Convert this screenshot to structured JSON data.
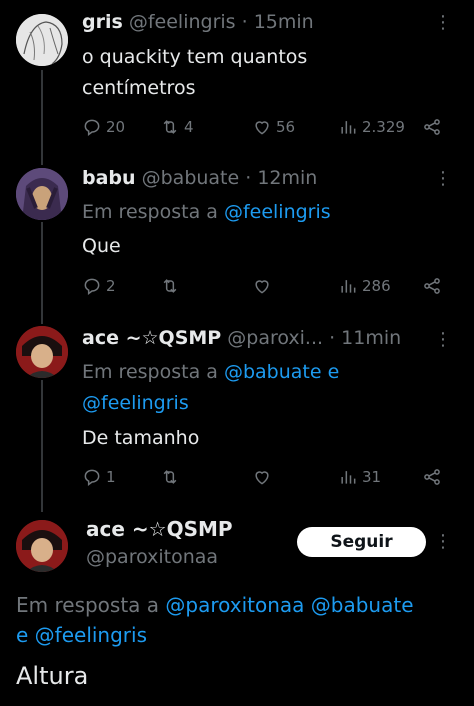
{
  "colors": {
    "background": "#000000",
    "text": "#e7e9ea",
    "muted": "#71767b",
    "link": "#1d9bf0"
  },
  "tweets": [
    {
      "name": "gris",
      "handle": "@feelingris",
      "time": "· 15min",
      "text_line1": "o quackity tem quantos",
      "text_line2": "centímetros",
      "replies": "20",
      "retweets": "4",
      "likes": "56",
      "views": "2.329"
    },
    {
      "name": "babu",
      "handle": "@babuate",
      "time": "· 12min",
      "replying_prefix": "Em resposta a",
      "replying_mention": "@feelingris",
      "text": "Que",
      "replies": "2",
      "views": "286"
    },
    {
      "name": "ace ~☆QSMP",
      "handle": "@paroxi...",
      "time": "· 11min",
      "replying_prefix": "Em resposta a",
      "replying_mention1": "@babuate e",
      "replying_mention2": "@feelingris",
      "text": "De tamanho",
      "replies": "1",
      "views": "31"
    }
  ],
  "focus": {
    "name": "ace ~☆QSMP",
    "handle": "@paroxitonaa",
    "follow_label": "Seguir",
    "replying_prefix": "Em resposta a",
    "mention1": "@paroxitonaa",
    "mention2": "@babuate",
    "conj": "e",
    "mention3": "@feelingris",
    "text": "Altura"
  },
  "icons": {
    "more": "more-vertical-icon",
    "reply": "reply-icon",
    "retweet": "retweet-icon",
    "like": "heart-icon",
    "views": "views-icon",
    "share": "share-icon"
  }
}
